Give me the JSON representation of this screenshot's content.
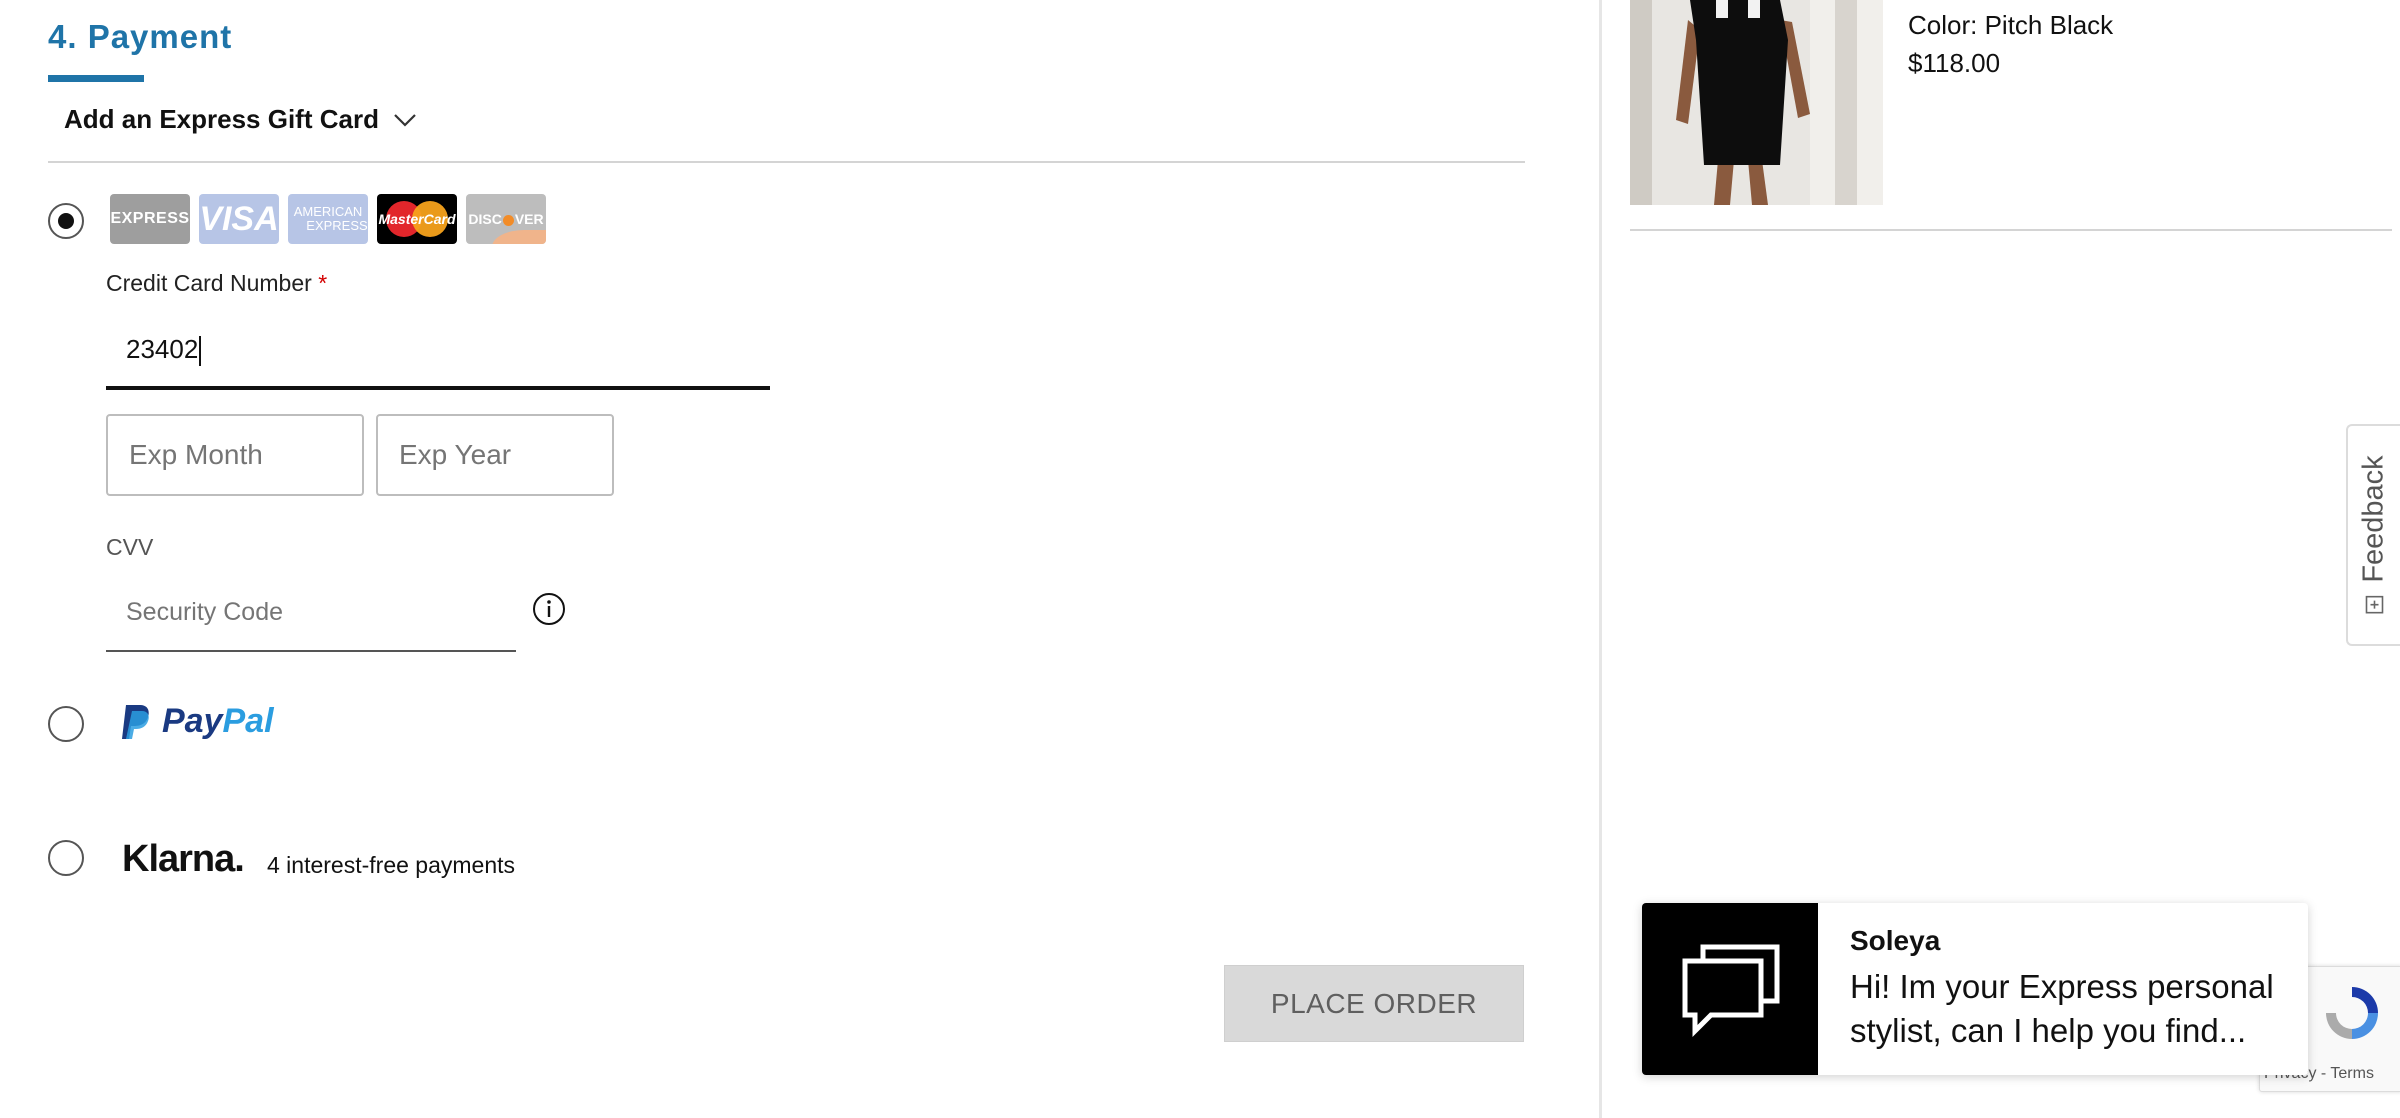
{
  "payment": {
    "section_title": "4. Payment",
    "gift_card_label": "Add an Express Gift Card",
    "card_logos": {
      "express": "EXPRESS",
      "visa": "VISA",
      "amex_line1": "AMERICAN",
      "amex_line2": "EXPRESS",
      "mastercard": "MasterCard",
      "discover_a": "DISC",
      "discover_b": "VER"
    },
    "credit_card": {
      "label": "Credit Card Number",
      "required_mark": "*",
      "value": "23402"
    },
    "exp_month_placeholder": "Exp Month",
    "exp_year_placeholder": "Exp Year",
    "cvv": {
      "label": "CVV",
      "placeholder": "Security Code"
    },
    "paypal": {
      "pay": "Pay",
      "pal": "Pal"
    },
    "klarna": {
      "logo": "Klarna.",
      "text": "4 interest-free payments"
    },
    "selected_method": "credit-card",
    "place_order_label": "PLACE ORDER"
  },
  "order_summary": {
    "color_label": "Color: Pitch Black",
    "price": "$118.00"
  },
  "feedback": {
    "label": "Feedback"
  },
  "chat": {
    "name": "Soleya",
    "message": "Hi! Im your Express personal stylist, can I help you find..."
  },
  "recaptcha": {
    "terms": "Privacy - Terms"
  },
  "colors": {
    "accent": "#1f74a8",
    "required": "#d40000",
    "button_disabled_bg": "#d9d9d9"
  }
}
